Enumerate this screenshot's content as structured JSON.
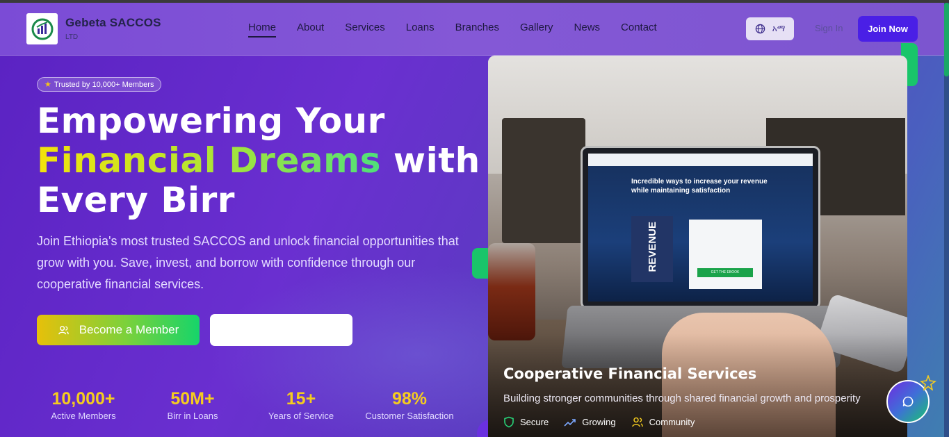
{
  "nav": {
    "brand_name": "Gebeta SACCOS",
    "brand_sub": "LTD",
    "menu": [
      "Home",
      "About",
      "Services",
      "Loans",
      "Branches",
      "Gallery",
      "News",
      "Contact"
    ],
    "active": "Home",
    "lang_label": "አማ",
    "signin_label": "Sign In",
    "join_label": "Join Now"
  },
  "hero": {
    "badge": "Trusted by 10,000+ Members",
    "title_line1": "Empowering Your",
    "title_highlight": "Financial Dreams",
    "title_with": " with",
    "title_line3": "Every Birr",
    "lead": "Join Ethiopia's most trusted SACCOS and unlock financial opportunities that grow with you. Save, invest, and borrow with confidence through our cooperative financial services.",
    "cta_primary": "Become a Member",
    "cta_secondary": ""
  },
  "stats": [
    {
      "value": "10,000+",
      "label": "Active Members"
    },
    {
      "value": "50M+",
      "label": "Birr in Loans"
    },
    {
      "value": "15+",
      "label": "Years of Service"
    },
    {
      "value": "98%",
      "label": "Customer Satisfaction"
    }
  ],
  "card": {
    "screen_heading": "Incredible ways to increase your revenue while maintaining satisfaction",
    "screen_book": "REVENUE",
    "screen_button": "GET THE EBOOK",
    "title": "Cooperative Financial Services",
    "subtitle": "Building stronger communities through shared financial growth and prosperity",
    "tags": [
      "Secure",
      "Growing",
      "Community"
    ]
  },
  "colors": {
    "accent": "#4a1fe6",
    "stat": "#f5cc1f",
    "green": "#19c56a"
  }
}
